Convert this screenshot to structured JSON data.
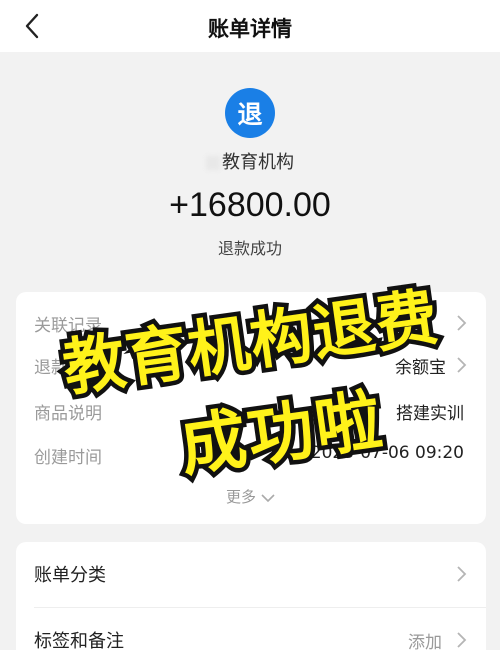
{
  "header": {
    "title": "账单详情",
    "back_icon": "chevron-left-icon"
  },
  "summary": {
    "icon_char": "退",
    "icon_color": "#1a7fe6",
    "merchant": "教育机构",
    "amount": "+16800.00",
    "status": "退款成功"
  },
  "details": {
    "rows": [
      {
        "label": "关联记录",
        "value": ""
      },
      {
        "label": "退款方式",
        "value": "余额宝"
      },
      {
        "label": "商品说明",
        "value": "搭建实训"
      },
      {
        "label": "创建时间",
        "value": "2023-07-06 09:20"
      }
    ],
    "more_label": "更多"
  },
  "extra": {
    "rows": [
      {
        "label": "账单分类",
        "value": ""
      },
      {
        "label": "标签和备注",
        "value": "添加"
      }
    ]
  },
  "overlay": {
    "line1": "教育机构退费",
    "line2": "成功啦",
    "color": "#fff21a",
    "outline": "#111111"
  }
}
